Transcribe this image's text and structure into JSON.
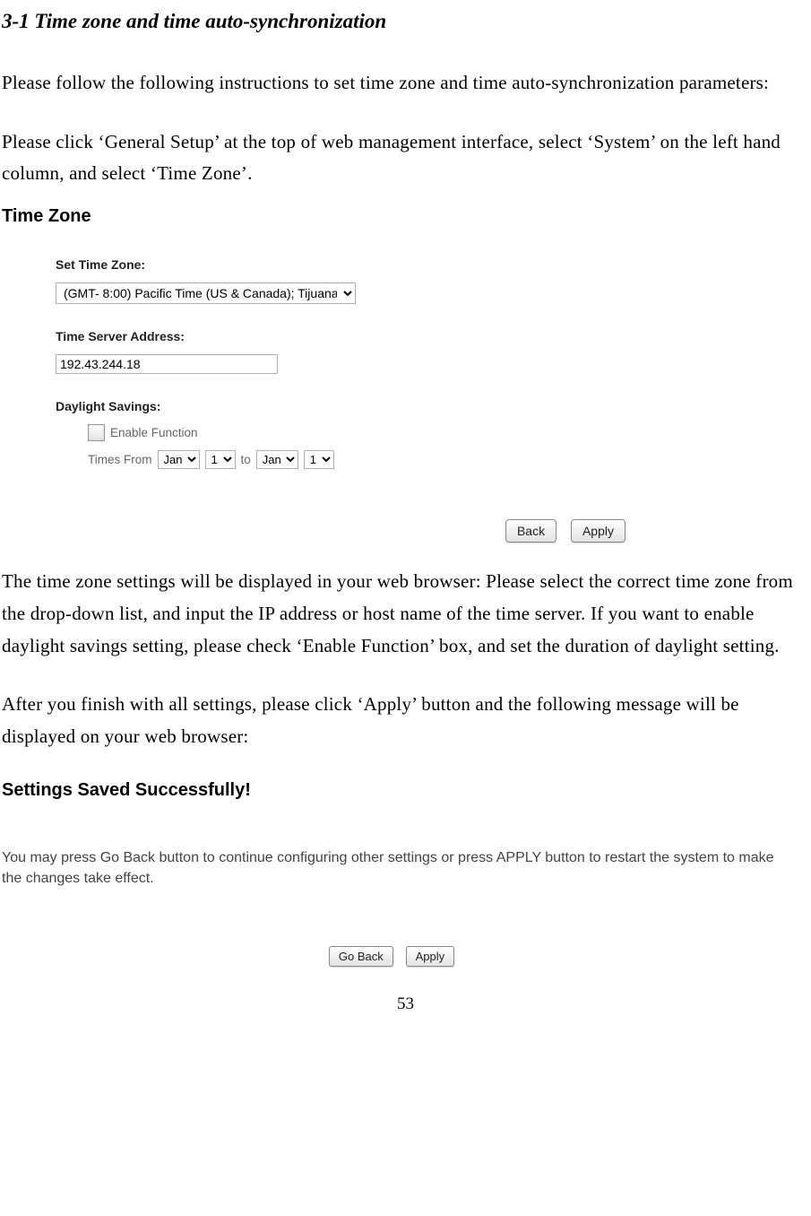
{
  "doc": {
    "section_title": "3-1 Time zone and time auto-synchronization",
    "p1": "Please follow the following instructions to set time zone and time auto-synchronization parameters:",
    "p2": "Please click ‘General Setup’ at the top of web management interface, select ‘System’ on the left hand column, and select ‘Time Zone’.",
    "p3": "The time zone settings will be displayed in your web browser: Please select the correct time zone from the drop-down list, and input the IP address or host name of the time server. If you want to enable daylight savings setting, please check ‘Enable Function’ box, and set the duration of daylight setting.",
    "p4": "After you finish with all settings, please click ‘Apply’ button and the following message will be displayed on your web browser:",
    "page_number": "53"
  },
  "tz_panel": {
    "title": "Time Zone",
    "set_tz_label": "Set Time Zone:",
    "tz_value": "(GMT- 8:00) Pacific Time (US & Canada); Tijuana",
    "server_label": "Time Server Address:",
    "server_value": "192.43.244.18",
    "ds_label": "Daylight Savings:",
    "enable_label": "Enable Function",
    "times_from": "Times From",
    "to_label": "to",
    "month1": "Jan",
    "day1": "1",
    "month2": "Jan",
    "day2": "1",
    "back_btn": "Back",
    "apply_btn": "Apply"
  },
  "saved_panel": {
    "title": "Settings Saved Successfully!",
    "msg": "You may press Go Back button to continue configuring other settings or press APPLY button to restart the system to make the changes take effect.",
    "go_back_btn": "Go Back",
    "apply_btn": "Apply"
  }
}
